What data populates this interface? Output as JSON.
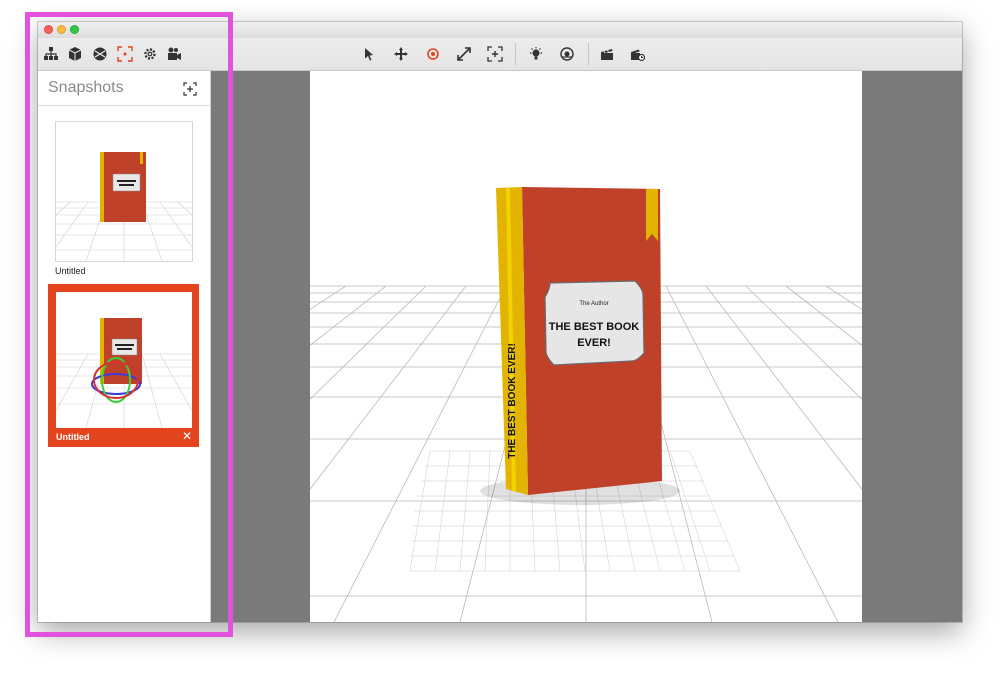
{
  "window": {
    "toolbar_left_icons": [
      "scene-tree-icon",
      "object-cube-icon",
      "materials-ball-icon",
      "snapshots-icon",
      "settings-gear-icon",
      "camera-icon"
    ],
    "toolbar_center_icons": [
      "select-arrow-icon",
      "move-icon",
      "rotate-icon",
      "scale-icon",
      "frame-icon",
      "light-bulb-icon",
      "environment-icon",
      "clapper-icon",
      "render-icon"
    ],
    "accent_color": "#e2451e"
  },
  "sidebar": {
    "title": "Snapshots",
    "snapshots": [
      {
        "label": "Untitled",
        "selected": false
      },
      {
        "label": "Untitled",
        "selected": true,
        "close_glyph": "✕"
      }
    ]
  },
  "scene": {
    "book_author": "The Author",
    "book_title_line1": "THE BEST BOOK",
    "book_title_line2": "EVER!",
    "spine_title": "THE BEST BOOK EVER!",
    "book_color": "#c0412a",
    "spine_color": "#e2b400"
  },
  "highlight_color": "#e153dd"
}
